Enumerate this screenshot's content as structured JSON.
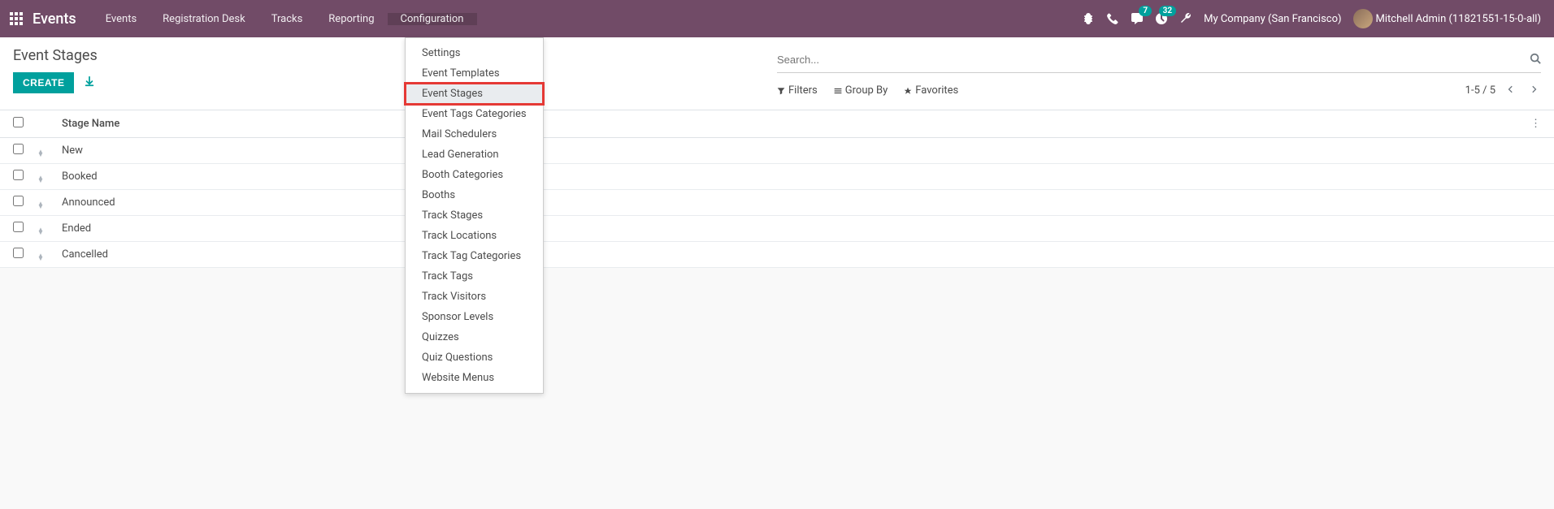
{
  "navbar": {
    "brand": "Events",
    "menu": [
      "Events",
      "Registration Desk",
      "Tracks",
      "Reporting",
      "Configuration"
    ],
    "active_menu_index": 4,
    "chat_badge": "7",
    "clock_badge": "32",
    "company": "My Company (San Francisco)",
    "user": "Mitchell Admin (11821551-15-0-all)"
  },
  "dropdown": {
    "items": [
      "Settings",
      "Event Templates",
      "Event Stages",
      "Event Tags Categories",
      "Mail Schedulers",
      "Lead Generation",
      "Booth Categories",
      "Booths",
      "Track Stages",
      "Track Locations",
      "Track Tag Categories",
      "Track Tags",
      "Track Visitors",
      "Sponsor Levels",
      "Quizzes",
      "Quiz Questions",
      "Website Menus"
    ],
    "highlighted_index": 2
  },
  "control": {
    "title": "Event Stages",
    "create_label": "CREATE",
    "search_placeholder": "Search...",
    "filters_label": "Filters",
    "groupby_label": "Group By",
    "favorites_label": "Favorites",
    "pager": "1-5 / 5"
  },
  "list": {
    "header": "Stage Name",
    "rows": [
      "New",
      "Booked",
      "Announced",
      "Ended",
      "Cancelled"
    ]
  }
}
